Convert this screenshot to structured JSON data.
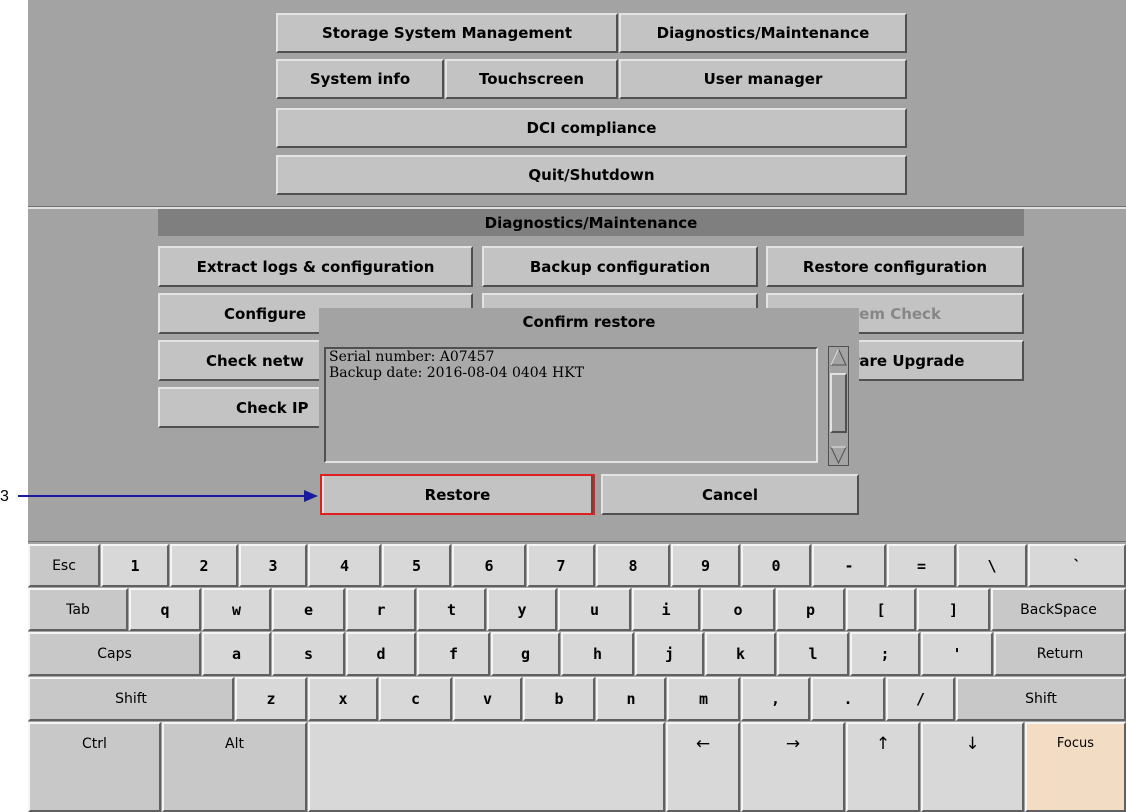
{
  "menu": {
    "storage": "Storage System Management",
    "diagnostics": "Diagnostics/Maintenance",
    "system_info": "System info",
    "touchscreen": "Touchscreen",
    "user_manager": "User manager",
    "dci": "DCI compliance",
    "quit": "Quit/Shutdown"
  },
  "panel": {
    "title": "Diagnostics/Maintenance",
    "extract": "Extract logs & configuration",
    "backup": "Backup configuration",
    "restore_config": "Restore configuration",
    "configure": "Configure",
    "system_check": "tem Check",
    "check_network": "Check netw",
    "firmware": "rare Upgrade",
    "check_ip": "Check IP"
  },
  "dialog": {
    "title": "Confirm restore",
    "lines": [
      "Serial number: A07457",
      "Backup date: 2016-08-04 0404 HKT"
    ],
    "restore": "Restore",
    "cancel": "Cancel"
  },
  "annotation": {
    "label": "3"
  },
  "keyboard": {
    "row1": [
      "Esc",
      "1",
      "2",
      "3",
      "4",
      "5",
      "6",
      "7",
      "8",
      "9",
      "0",
      "-",
      "=",
      "\\",
      "`"
    ],
    "row2": [
      "Tab",
      "q",
      "w",
      "e",
      "r",
      "t",
      "y",
      "u",
      "i",
      "o",
      "p",
      "[",
      "]",
      "BackSpace"
    ],
    "row3": [
      "Caps",
      "a",
      "s",
      "d",
      "f",
      "g",
      "h",
      "j",
      "k",
      "l",
      ";",
      "'",
      "Return"
    ],
    "row4": [
      "Shift",
      "z",
      "x",
      "c",
      "v",
      "b",
      "n",
      "m",
      ",",
      ".",
      "/",
      "Shift"
    ],
    "row5": [
      "Ctrl",
      "Alt",
      "",
      "←",
      "→",
      "↑",
      "↓",
      "Focus"
    ]
  },
  "colors": {
    "background": "#a3a3a3",
    "button": "#c3c3c3",
    "highlight": "#e02020",
    "focus": "#f2dcc3",
    "annotation": "#1a1aa0"
  }
}
